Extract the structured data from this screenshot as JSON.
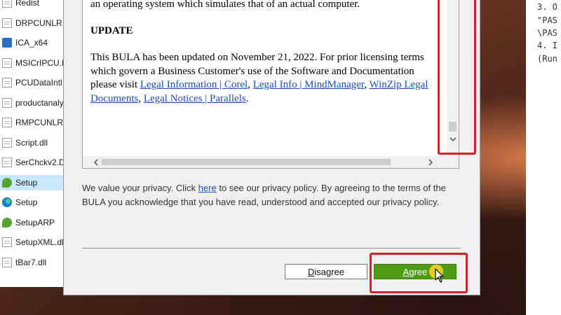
{
  "files": [
    {
      "name": "Redist",
      "icon": "document-icon"
    },
    {
      "name": "DRPCUNLR.d",
      "icon": "document-icon"
    },
    {
      "name": "ICA_x64",
      "icon": "config-icon"
    },
    {
      "name": "MSICrIPCU.D",
      "icon": "document-icon"
    },
    {
      "name": "PCUDataIntl.",
      "icon": "document-icon"
    },
    {
      "name": "productanaly",
      "icon": "document-icon"
    },
    {
      "name": "RMPCUNLR.",
      "icon": "document-icon"
    },
    {
      "name": "Script.dll",
      "icon": "document-icon"
    },
    {
      "name": "SerChckv2.D",
      "icon": "document-icon"
    },
    {
      "name": "Setup",
      "icon": "setup-app-icon",
      "selected": true
    },
    {
      "name": "Setup",
      "icon": "edge-browser-icon"
    },
    {
      "name": "SetupARP",
      "icon": "setup-app-icon"
    },
    {
      "name": "SetupXML.dl",
      "icon": "document-icon"
    },
    {
      "name": "tBar7.dll",
      "icon": "document-icon"
    }
  ],
  "side_text": {
    "lines": [
      "3. O",
      "\"PAS",
      "\\PAS",
      "4. I",
      "(Run"
    ]
  },
  "license": {
    "line1": "an operating system which simulates that of an actual computer.",
    "heading": "UPDATE",
    "para_intro": "This BULA has been updated on November 21, 2022. For prior licensing terms which govern a Business Customer's use of the Software and Documentation please visit ",
    "link_corel": "Legal Information | Corel",
    "sep1": ", ",
    "link_mindmanager": "Legal Info | MindManager",
    "sep2": ", ",
    "link_winzip": "WinZip Legal Documents",
    "sep3": ", ",
    "link_parallels": "Legal Notices | Parallels",
    "para_end": "."
  },
  "privacy": {
    "before_link": "We value your privacy. Click ",
    "link": "here",
    "after_link": " to see our privacy policy. By agreeing to the terms of the BULA you acknowledge that you have read, understood and accepted our privacy policy."
  },
  "buttons": {
    "disagree_first": "D",
    "disagree_rest": "isagree",
    "agree_first": "A",
    "agree_rest": "gree"
  },
  "colors": {
    "highlight": "#d6202a",
    "agree": "#4f9b12",
    "link": "#1a4fb5"
  }
}
